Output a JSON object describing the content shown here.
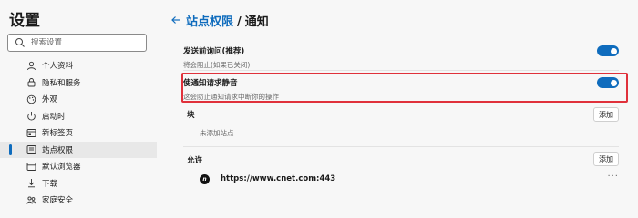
{
  "sidebar": {
    "title": "设置",
    "search": {
      "placeholder": "搜索设置"
    },
    "items": [
      {
        "label": "个人资料",
        "icon": "profile-icon"
      },
      {
        "label": "隐私和服务",
        "icon": "lock-icon"
      },
      {
        "label": "外观",
        "icon": "palette-icon"
      },
      {
        "label": "启动时",
        "icon": "power-icon"
      },
      {
        "label": "新标签页",
        "icon": "new-tab-icon"
      },
      {
        "label": "站点权限",
        "icon": "site-permissions-icon",
        "active": true
      },
      {
        "label": "默认浏览器",
        "icon": "browser-icon"
      },
      {
        "label": "下载",
        "icon": "download-icon"
      },
      {
        "label": "家庭安全",
        "icon": "family-icon"
      }
    ]
  },
  "header": {
    "back_icon": "back-arrow-icon",
    "parent": "站点权限",
    "separator": "/",
    "current": "通知"
  },
  "settings": {
    "ask_before_sending": {
      "title": "发送前询问(推荐)",
      "description": "将会阻止(如果已关闭)",
      "enabled": true
    },
    "quiet_requests": {
      "title": "使通知请求静音",
      "description": "这会防止通知请求中断你的操作",
      "enabled": true
    }
  },
  "block": {
    "label": "块",
    "add_label": "添加",
    "empty_text": "未添加站点"
  },
  "allow": {
    "label": "允许",
    "add_label": "添加",
    "sites": [
      {
        "url": "https://www.cnet.com:443",
        "favicon_text": "n",
        "more": "···"
      }
    ]
  },
  "colors": {
    "accent": "#0f6cbd",
    "highlight": "#e0313b",
    "background": "#f7f7f7"
  }
}
